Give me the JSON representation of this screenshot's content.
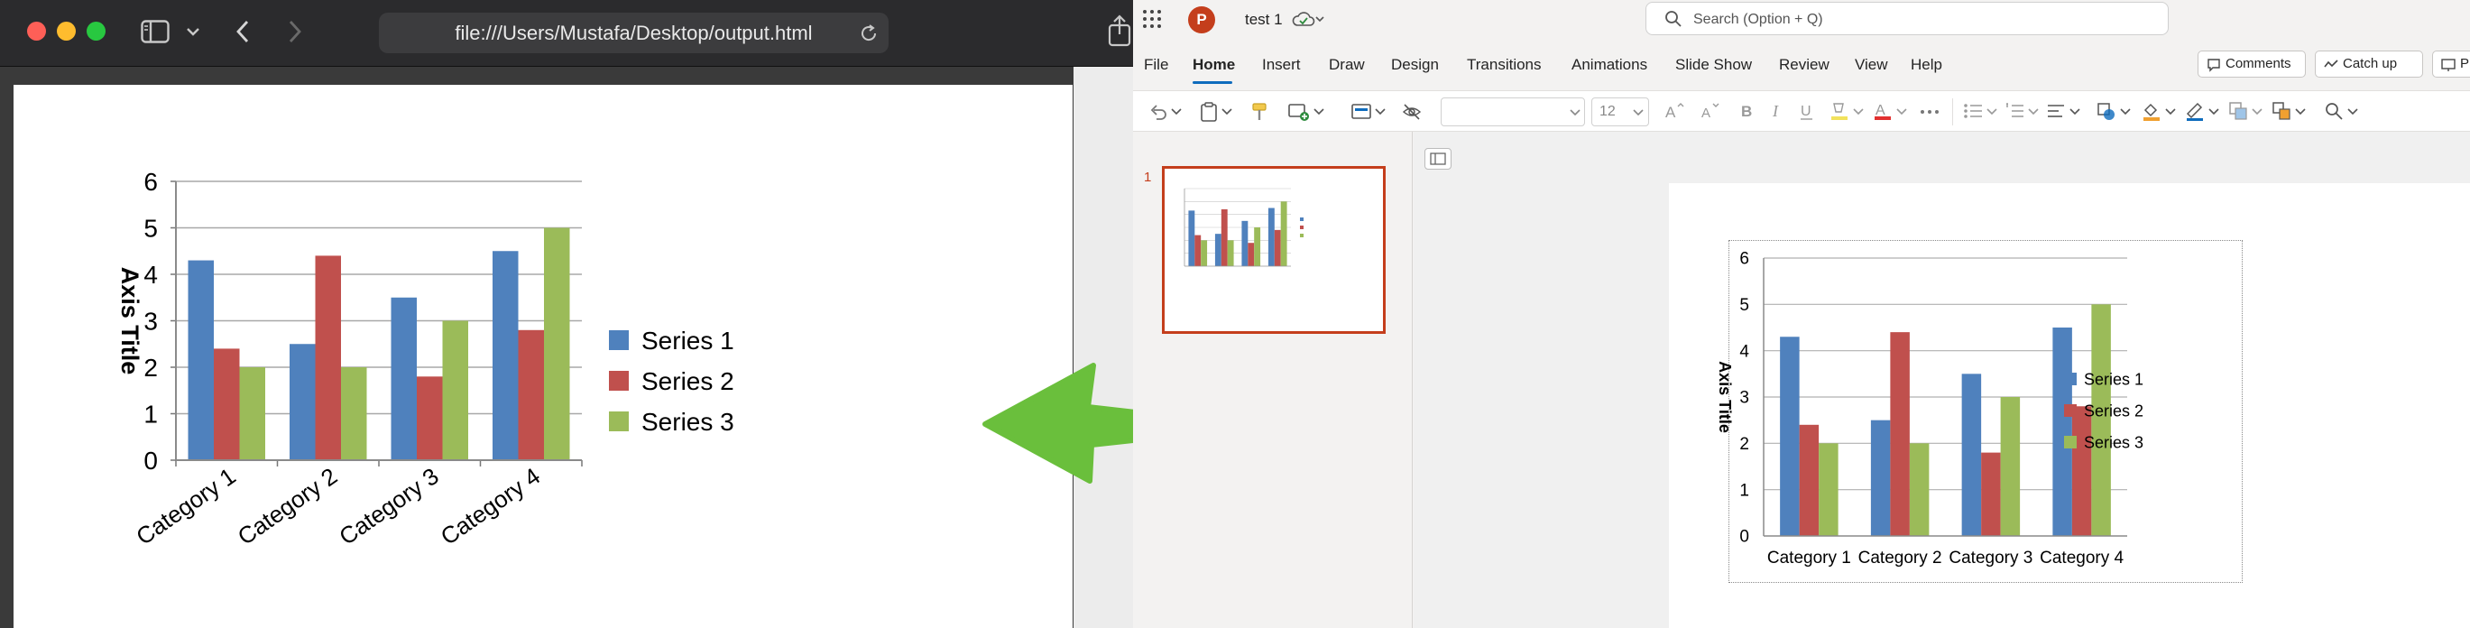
{
  "safari": {
    "url": "file:///Users/Mustafa/Desktop/output.html"
  },
  "ppt": {
    "app_letter": "P",
    "doc_title": "test 1",
    "search_placeholder": "Search (Option + Q)",
    "menus": [
      "File",
      "Home",
      "Insert",
      "Draw",
      "Design",
      "Transitions",
      "Animations",
      "Slide Show",
      "Review",
      "View",
      "Help"
    ],
    "active_menu": "Home",
    "comments_label": "Comments",
    "catchup_label": "Catch up",
    "present_label": "Pre",
    "font_size": "12",
    "slide_number": "1"
  },
  "colors": {
    "series1": "#4f81bd",
    "series2": "#c0504d",
    "series3": "#9bbb59",
    "accent": "#c43e1c",
    "arrow": "#6abf3c"
  },
  "chart_data": {
    "type": "bar",
    "categories": [
      "Category 1",
      "Category 2",
      "Category 3",
      "Category 4"
    ],
    "series": [
      {
        "name": "Series 1",
        "values": [
          4.3,
          2.5,
          3.5,
          4.5
        ]
      },
      {
        "name": "Series 2",
        "values": [
          2.4,
          4.4,
          1.8,
          2.8
        ]
      },
      {
        "name": "Series 3",
        "values": [
          2.0,
          2.0,
          3.0,
          5.0
        ]
      }
    ],
    "ylabel": "Axis Title",
    "ylim": [
      0,
      6
    ],
    "yticks": [
      0,
      1,
      2,
      3,
      4,
      5,
      6
    ],
    "grid": true,
    "legend": "right"
  }
}
